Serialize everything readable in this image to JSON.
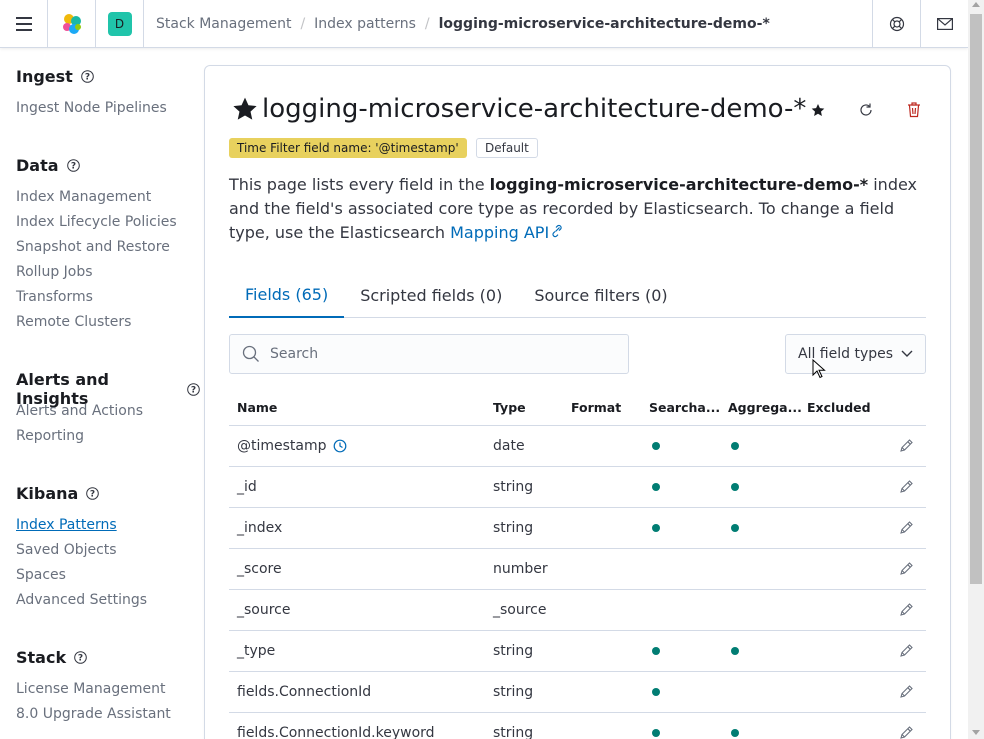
{
  "header": {
    "space_initial": "D",
    "breadcrumbs": [
      "Stack Management",
      "Index patterns",
      "logging-microservice-architecture-demo-*"
    ]
  },
  "sidebar": {
    "groups": [
      {
        "title": "Ingest",
        "items": [
          "Ingest Node Pipelines"
        ]
      },
      {
        "title": "Data",
        "items": [
          "Index Management",
          "Index Lifecycle Policies",
          "Snapshot and Restore",
          "Rollup Jobs",
          "Transforms",
          "Remote Clusters"
        ]
      },
      {
        "title": "Alerts and Insights",
        "items": [
          "Alerts and Actions",
          "Reporting"
        ]
      },
      {
        "title": "Kibana",
        "items": [
          "Index Patterns",
          "Saved Objects",
          "Spaces",
          "Advanced Settings"
        ]
      },
      {
        "title": "Stack",
        "items": [
          "License Management",
          "8.0 Upgrade Assistant"
        ]
      }
    ],
    "active_item": "Index Patterns"
  },
  "page": {
    "title": "logging-microservice-architecture-demo-*",
    "badge_time": "Time Filter field name: '@timestamp'",
    "badge_default": "Default",
    "desc_part1": "This page lists every field in the ",
    "desc_bold": "logging-microservice-architecture-demo-*",
    "desc_part2": " index and the field's associated core type as recorded by Elasticsearch. To change a field type, use the Elasticsearch ",
    "desc_link": "Mapping API"
  },
  "tabs": [
    "Fields (65)",
    "Scripted fields (0)",
    "Source filters (0)"
  ],
  "search": {
    "placeholder": "Search",
    "value": ""
  },
  "filter": {
    "label": "All field types"
  },
  "table": {
    "columns": [
      "Name",
      "Type",
      "Format",
      "Searcha...",
      "Aggrega...",
      "Excluded"
    ],
    "rows": [
      {
        "name": "@timestamp",
        "type": "date",
        "searchable": true,
        "aggregatable": true,
        "time": true
      },
      {
        "name": "_id",
        "type": "string",
        "searchable": true,
        "aggregatable": true
      },
      {
        "name": "_index",
        "type": "string",
        "searchable": true,
        "aggregatable": true
      },
      {
        "name": "_score",
        "type": "number",
        "searchable": false,
        "aggregatable": false
      },
      {
        "name": "_source",
        "type": "_source",
        "searchable": false,
        "aggregatable": false
      },
      {
        "name": "_type",
        "type": "string",
        "searchable": true,
        "aggregatable": true
      },
      {
        "name": "fields.ConnectionId",
        "type": "string",
        "searchable": true,
        "aggregatable": false
      },
      {
        "name": "fields.ConnectionId.keyword",
        "type": "string",
        "searchable": true,
        "aggregatable": true
      }
    ]
  },
  "colors": {
    "accent": "#006bb8",
    "dot": "#017d73",
    "badge_time": "#e8d15e",
    "avatar": "#20c4aa",
    "delete": "#bd271e"
  }
}
